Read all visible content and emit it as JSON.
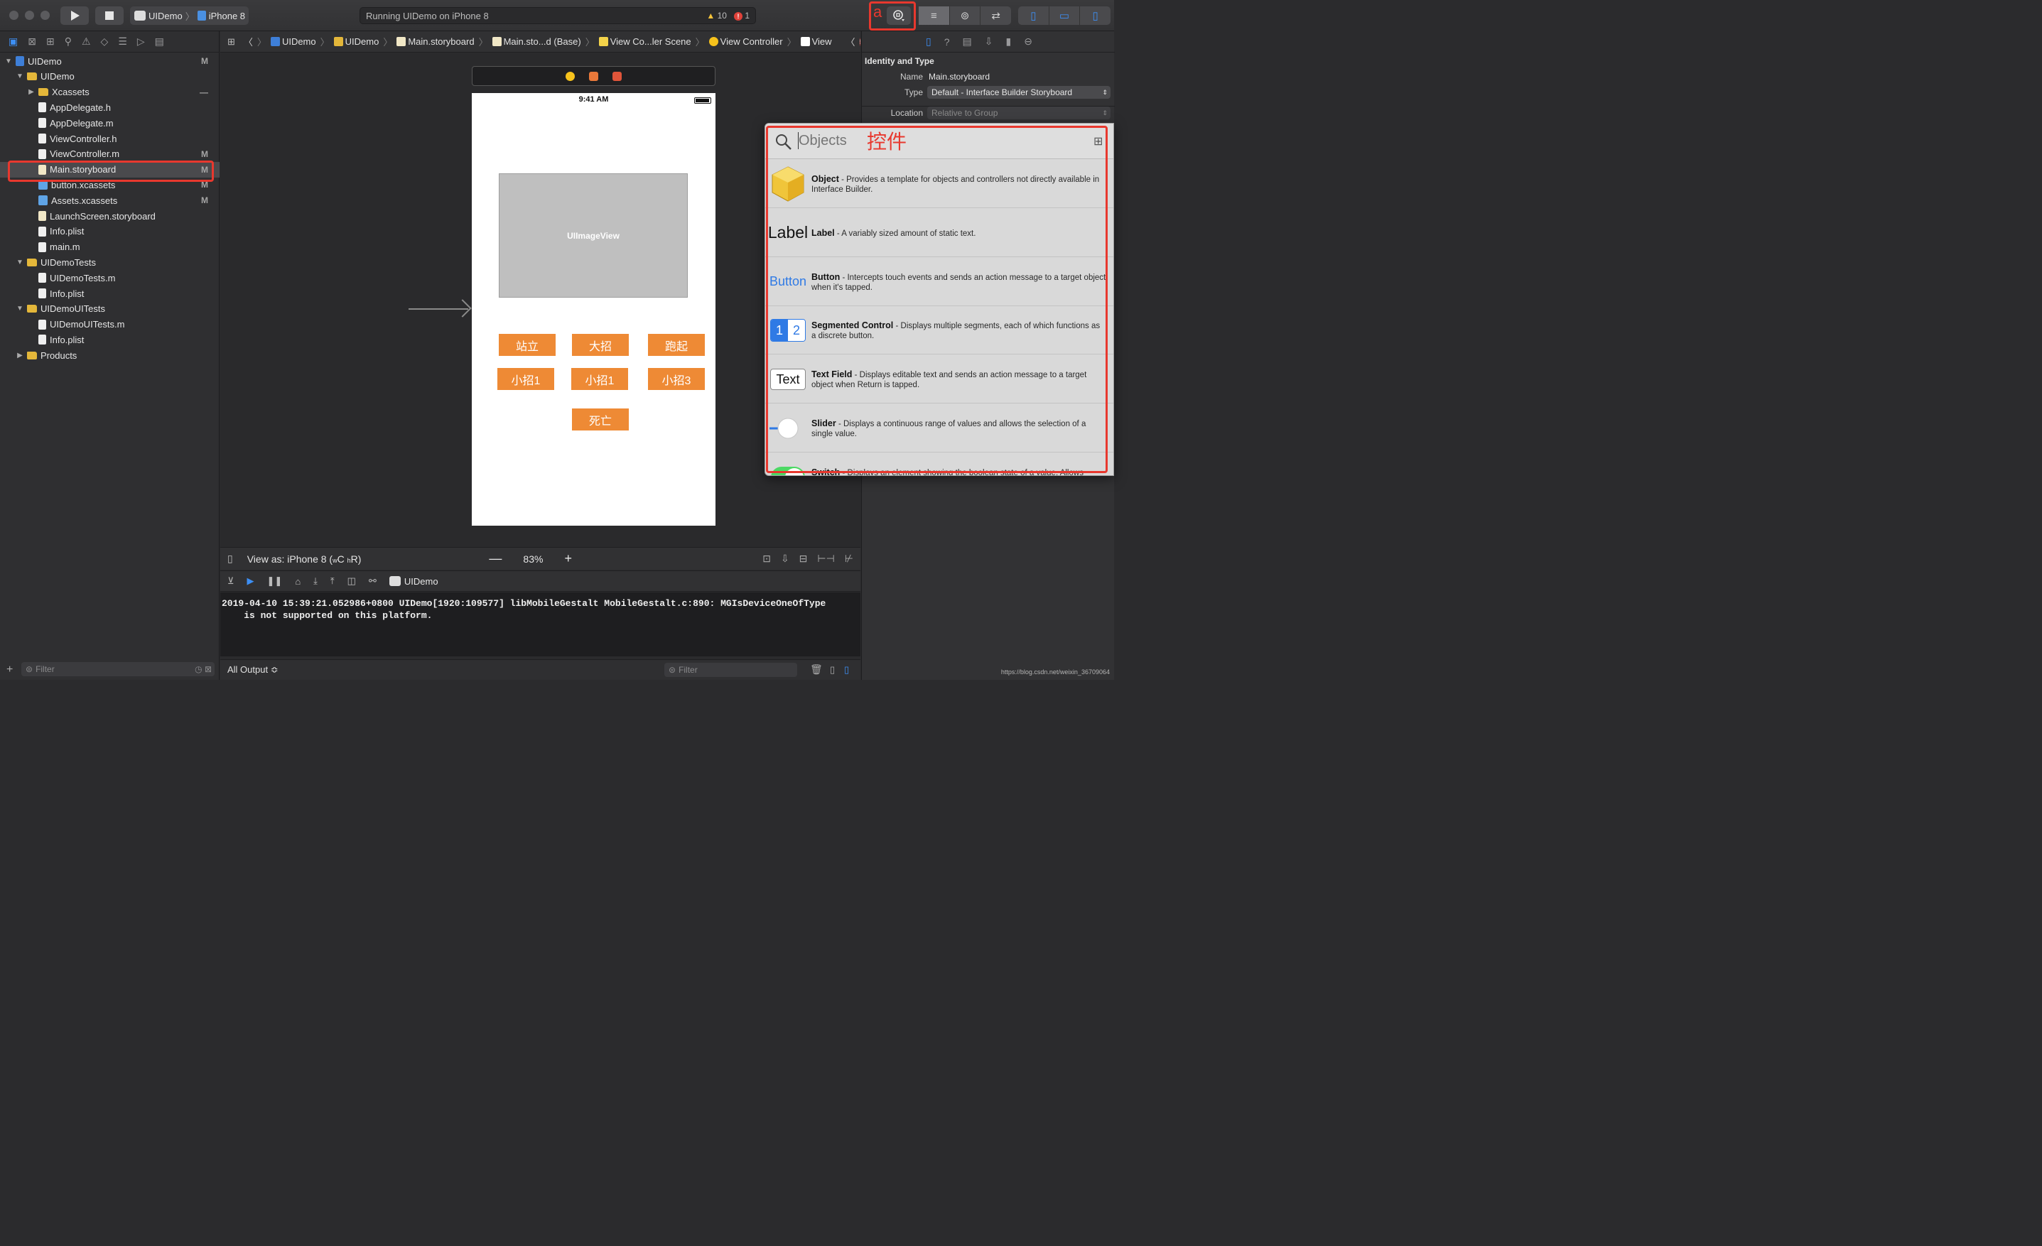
{
  "toolbar": {
    "scheme": "UIDemo",
    "device": "iPhone 8",
    "activity": "Running UIDemo on iPhone 8",
    "warnings": "10",
    "errors": "1",
    "annotation_letter": "a"
  },
  "navigator": {
    "tree": [
      {
        "label": "UIDemo",
        "level": 0,
        "icon": "project-icon",
        "expanded": true,
        "badge": "M"
      },
      {
        "label": "UIDemo",
        "level": 1,
        "icon": "folder-icon",
        "expanded": true,
        "badge": ""
      },
      {
        "label": "Xcassets",
        "level": 2,
        "icon": "folder-icon",
        "collapsed": true,
        "badge": "—"
      },
      {
        "label": "AppDelegate.h",
        "level": 2,
        "icon": "header-file-icon",
        "badge": ""
      },
      {
        "label": "AppDelegate.m",
        "level": 2,
        "icon": "source-file-icon",
        "badge": ""
      },
      {
        "label": "ViewController.h",
        "level": 2,
        "icon": "header-file-icon",
        "badge": ""
      },
      {
        "label": "ViewController.m",
        "level": 2,
        "icon": "source-file-icon",
        "badge": "M"
      },
      {
        "label": "Main.storyboard",
        "level": 2,
        "icon": "storyboard-icon",
        "badge": "M",
        "selected": true
      },
      {
        "label": "button.xcassets",
        "level": 2,
        "icon": "assets-icon",
        "badge": "M"
      },
      {
        "label": "Assets.xcassets",
        "level": 2,
        "icon": "assets-icon",
        "badge": "M"
      },
      {
        "label": "LaunchScreen.storyboard",
        "level": 2,
        "icon": "storyboard-icon",
        "badge": ""
      },
      {
        "label": "Info.plist",
        "level": 2,
        "icon": "plist-icon",
        "badge": ""
      },
      {
        "label": "main.m",
        "level": 2,
        "icon": "source-file-icon",
        "badge": ""
      },
      {
        "label": "UIDemoTests",
        "level": 1,
        "icon": "folder-icon",
        "expanded": true,
        "badge": ""
      },
      {
        "label": "UIDemoTests.m",
        "level": 2,
        "icon": "source-file-icon",
        "badge": ""
      },
      {
        "label": "Info.plist",
        "level": 2,
        "icon": "plist-icon",
        "badge": ""
      },
      {
        "label": "UIDemoUITests",
        "level": 1,
        "icon": "folder-icon",
        "expanded": true,
        "badge": ""
      },
      {
        "label": "UIDemoUITests.m",
        "level": 2,
        "icon": "source-file-icon",
        "badge": ""
      },
      {
        "label": "Info.plist",
        "level": 2,
        "icon": "plist-icon",
        "badge": ""
      },
      {
        "label": "Products",
        "level": 1,
        "icon": "folder-icon",
        "collapsed": true,
        "badge": ""
      }
    ],
    "filter_placeholder": "Filter"
  },
  "jumpbar": {
    "items": [
      "UIDemo",
      "UIDemo",
      "Main.storyboard",
      "Main.sto...d (Base)",
      "View Co...ler Scene",
      "View Controller",
      "View"
    ]
  },
  "phone": {
    "time": "9:41 AM",
    "imageview_label": "UIImageView",
    "buttons_row1": [
      "站立",
      "大招",
      "跑起"
    ],
    "buttons_row2": [
      "小招1",
      "小招1",
      "小招3"
    ],
    "buttons_row3": [
      "死亡"
    ]
  },
  "canvas_bottom": {
    "view_as_prefix": "View as: iPhone 8 (",
    "size_w": "w",
    "size_c": "C",
    "size_h": "h",
    "size_r": "R)",
    "zoom": "83%"
  },
  "debug": {
    "target": "UIDemo",
    "console_text": "2019-04-10 15:39:21.052986+0800 UIDemo[1920:109577] libMobileGestalt MobileGestalt.c:890: MGIsDeviceOneOfType\n    is not supported on this platform.",
    "output_selector": "All Output ≎",
    "filter_placeholder": "Filter"
  },
  "inspector": {
    "section_title": "Identity and Type",
    "name_label": "Name",
    "name_value": "Main.storyboard",
    "type_label": "Type",
    "type_value": "Default - Interface Builder Storyboard",
    "location_label": "Location",
    "location_value": "Relative to Group"
  },
  "library": {
    "search_placeholder": "Objects",
    "annotation": "控件",
    "items": [
      {
        "title": "Object",
        "desc": " - Provides a template for objects and controllers not directly available in Interface Builder.",
        "thumb": "cube-icon"
      },
      {
        "title": "Label",
        "desc": " - A variably sized amount of static text.",
        "thumb": "label-icon",
        "thumb_text": "Label"
      },
      {
        "title": "Button",
        "desc": " - Intercepts touch events and sends an action message to a target object when it's tapped.",
        "thumb": "button-icon",
        "thumb_text": "Button"
      },
      {
        "title": "Segmented Control",
        "desc": " - Displays multiple segments, each of which functions as a discrete button.",
        "thumb": "segmented-icon",
        "thumb_seg1": "1",
        "thumb_seg2": "2"
      },
      {
        "title": "Text Field",
        "desc": " - Displays editable text and sends an action message to a target object when Return is tapped.",
        "thumb": "textfield-icon",
        "thumb_text": "Text"
      },
      {
        "title": "Slider",
        "desc": " - Displays a continuous range of values and allows the selection of a single value.",
        "thumb": "slider-icon"
      },
      {
        "title": "Switch",
        "desc": " - Displays an element showing the boolean state of a value. Allows",
        "thumb": "switch-icon"
      }
    ]
  },
  "watermark": "https://blog.csdn.net/weixin_36709064",
  "colors": {
    "accent": "#3d8ff5",
    "orange_button": "#ee8a35",
    "annotation_red": "#e8382e"
  }
}
